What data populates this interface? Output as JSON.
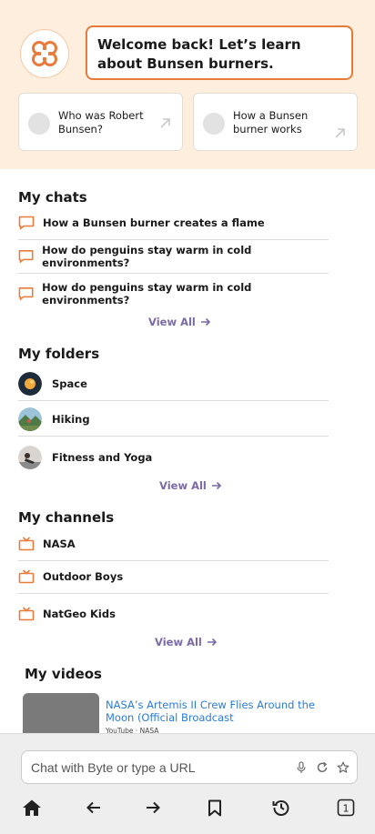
{
  "welcome": "Welcome back! Let’s learn about Bunsen burners.",
  "suggestions": [
    {
      "label": "Who was Robert Bunsen?"
    },
    {
      "label": "How a Bunsen burner works"
    }
  ],
  "chats": {
    "title": "My chats",
    "items": [
      "How a Bunsen burner creates a flame",
      "How do penguins stay warm in cold environments?",
      "How do penguins stay warm in cold environments?"
    ],
    "view_all": "View All"
  },
  "folders": {
    "title": "My folders",
    "items": [
      "Space",
      "Hiking",
      "Fitness and Yoga"
    ],
    "view_all": "View All"
  },
  "channels": {
    "title": "My channels",
    "items": [
      "NASA",
      "Outdoor Boys",
      "NatGeo Kids"
    ],
    "view_all": "View All"
  },
  "videos": {
    "title": "My videos",
    "items": [
      {
        "title": "NASA’s Artemis II Crew Flies Around the Moon (Official Broadcast",
        "source": "YouTube · NASA"
      }
    ]
  },
  "browser": {
    "url_placeholder": "Chat with Byte or type a URL",
    "tab_count": "1"
  },
  "colors": {
    "accent_orange": "#e87a3a",
    "hero_bg": "#fdeedd",
    "link_purple": "#7b6aa8",
    "video_link_blue": "#2b7bd8"
  }
}
